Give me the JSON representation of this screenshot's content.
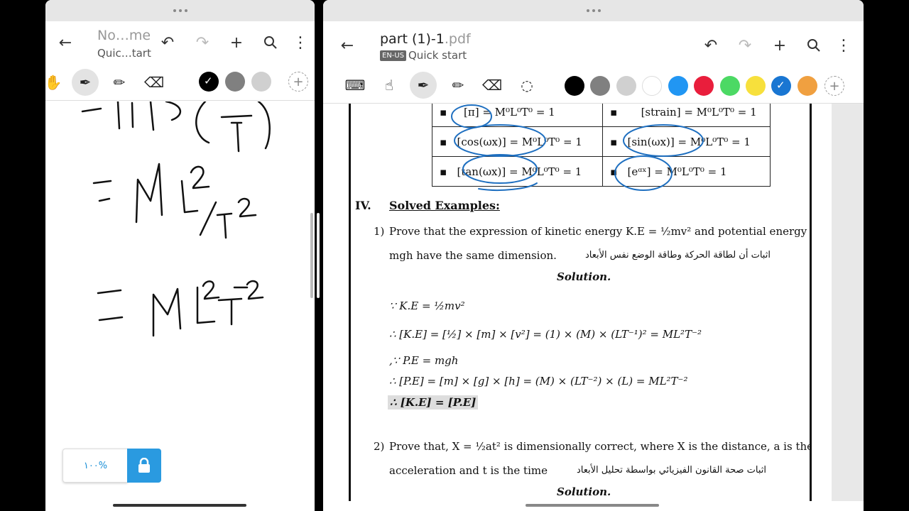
{
  "left_window": {
    "title": "No…me",
    "subtitle": "Quic…tart",
    "zoom": "١٠٠%",
    "colors": [
      "#000000",
      "#808080",
      "#d0d0d0"
    ],
    "selected_color": "#000000"
  },
  "right_window": {
    "title": "part (1)-1",
    "title_ext": ".pdf",
    "lang_badge": "EN-US",
    "subtitle": "Quick start",
    "colors": [
      "#000000",
      "#808080",
      "#d0d0d0",
      "#ffffff",
      "#2196f3",
      "#e91e3c",
      "#4cd964",
      "#f7e03c",
      "#1976d2",
      "#f0a040"
    ],
    "selected_color": "#1976d2"
  },
  "doc": {
    "table": [
      [
        "[π] = M⁰L⁰T⁰ = 1",
        "[strain] = M⁰L⁰T⁰ = 1"
      ],
      [
        "[cos(ωx)] = M⁰L⁰T⁰ = 1",
        "[sin(ωx)] = M⁰L⁰T⁰ = 1"
      ],
      [
        "[tan(ωx)] = M⁰L⁰T⁰ = 1",
        "[eᵅˣ] = M⁰L⁰T⁰ = 1"
      ]
    ],
    "bullet": "▪",
    "section_num": "IV.",
    "section_title": "Solved Examples:",
    "ex1_num": "1)",
    "ex1_line1": "Prove that the expression of kinetic energy K.E = ½mv² and potential energy P.E =",
    "ex1_line2": "mgh have the same dimension.",
    "ex1_ar": "اثبات أن لطاقة الحركة وطاقة الوضع نفس الأبعاد",
    "solution": "Solution.",
    "eq1": "∵ K.E = ½mv²",
    "eq2": "∴ [K.E] = [½] × [m] × [v²] = (1) × (M) × (LT⁻¹)² = ML²T⁻²",
    "eq3": ",∵ P.E = mgh",
    "eq4": "∴ [P.E] = [m] × [g] × [h] = (M) × (LT⁻²) × (L) = ML²T⁻²",
    "eq5": "∴ [K.E] = [P.E]",
    "ex2_num": "2)",
    "ex2_line1": "Prove that, X = ½at² is dimensionally correct, where X is the distance, a is the",
    "ex2_line2": "acceleration and t is the time",
    "ex2_ar": "اثبات صحة القانون الفيزيائي بواسطة تحليل الأبعاد",
    "solution2": "Solution."
  }
}
